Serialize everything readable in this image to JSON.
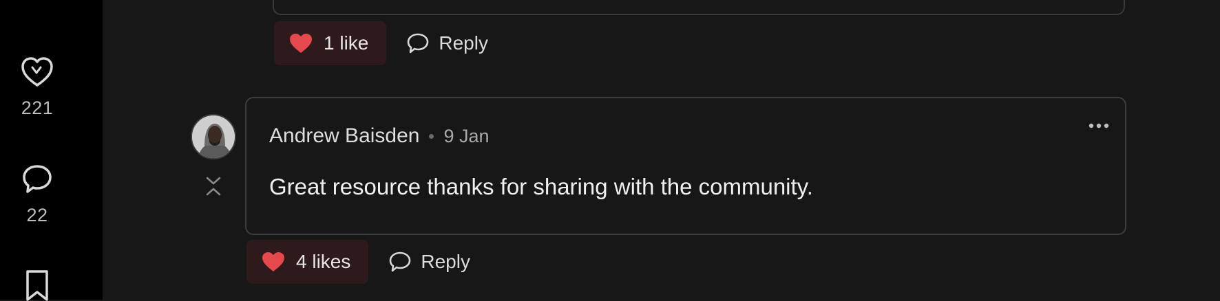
{
  "sidebar": {
    "likes_count": "221",
    "comments_count": "22",
    "icons": [
      "heart-outline-icon",
      "comment-icon",
      "bookmark-icon"
    ]
  },
  "prev_comment": {
    "like_label": "1 like",
    "reply_label": "Reply"
  },
  "comment": {
    "author": "Andrew Baisden",
    "date": "9 Jan",
    "body": "Great resource thanks for sharing with the community.",
    "like_label": "4 likes",
    "reply_label": "Reply"
  },
  "colors": {
    "background": "#171717",
    "sidebar": "#000000",
    "like_bg": "#2e1a1a",
    "heart": "#e5484d",
    "border": "#3d3d3d"
  }
}
